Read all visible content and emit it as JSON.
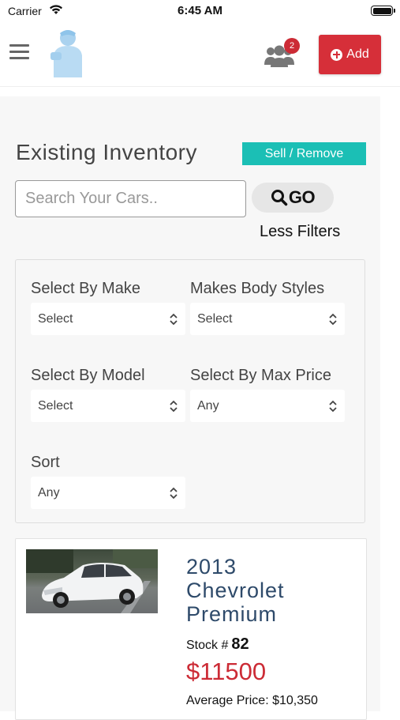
{
  "status_bar": {
    "carrier": "Carrier",
    "time": "6:45 AM"
  },
  "header": {
    "menu_icon": "hamburger-menu-icon",
    "logo": "person-logo",
    "users_icon": "users-group-icon",
    "users_badge": "2",
    "add_label": "Add",
    "add_icon": "plus-circle-icon",
    "accent_color": "#d62f39"
  },
  "inventory": {
    "title": "Existing Inventory",
    "sell_remove_label": "Sell / Remove",
    "sell_color": "#1bbfb5",
    "search_placeholder": "Search Your Cars..",
    "search_value": "",
    "go_label": "GO",
    "less_filters_label": "Less Filters"
  },
  "filters": {
    "make": {
      "label": "Select By Make",
      "value": "Select"
    },
    "body_styles": {
      "label": "Makes Body Styles",
      "value": "Select"
    },
    "model": {
      "label": "Select By Model",
      "value": "Select"
    },
    "max_price": {
      "label": "Select By Max Price",
      "value": "Any"
    },
    "sort": {
      "label": "Sort",
      "value": "Any"
    }
  },
  "cars": [
    {
      "title_lines": [
        "2013",
        "Chevrolet",
        "Premium"
      ],
      "stock_label": "Stock #",
      "stock_number": "82",
      "price": "$11500",
      "average_price": "Average Price: $10,350"
    }
  ]
}
